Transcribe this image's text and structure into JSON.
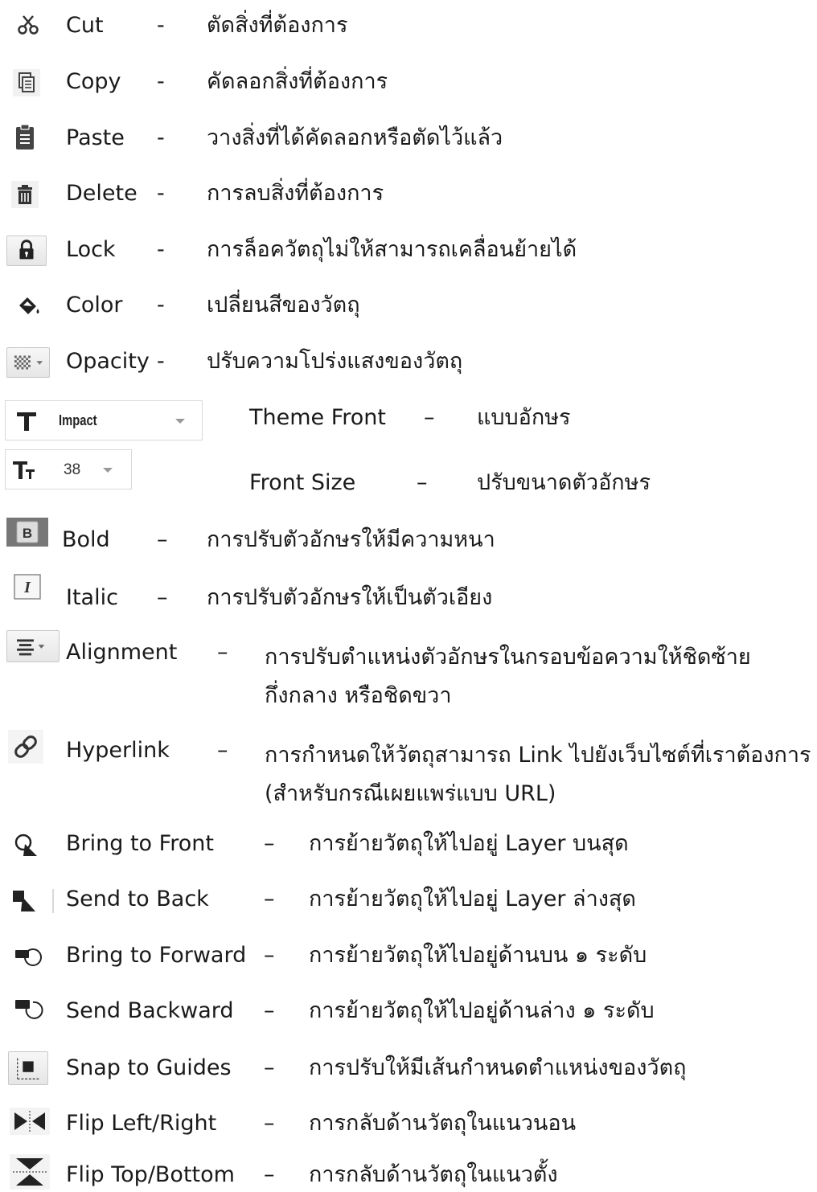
{
  "items": [
    {
      "icon": "scissors-icon",
      "label": "Cut",
      "sep": "-",
      "desc": "ตัดสิ่งที่ต้องการ"
    },
    {
      "icon": "copy-icon",
      "label": "Copy",
      "sep": "-",
      "desc": "คัดลอกสิ่งที่ต้องการ"
    },
    {
      "icon": "paste-icon",
      "label": "Paste",
      "sep": "-",
      "desc": "วางสิ่งที่ได้คัดลอกหรือตัดไว้แล้ว"
    },
    {
      "icon": "trash-icon",
      "label": "Delete",
      "sep": "-",
      "desc": "การลบสิ่งที่ต้องการ"
    },
    {
      "icon": "lock-icon",
      "label": "Lock",
      "sep": "-",
      "desc": "การล็อควัตถุไม่ให้สามารถเคลื่อนย้ายได้"
    },
    {
      "icon": "paint-bucket-icon",
      "label": "Color",
      "sep": "-",
      "desc": "เปลี่ยนสีของวัตถุ"
    },
    {
      "icon": "opacity-icon",
      "label": "Opacity",
      "sep": "-",
      "desc": "ปรับความโปร่งแสงของวัตถุ"
    },
    {
      "icon": "font-family-icon",
      "label": "Theme Front",
      "sep": "–",
      "desc": "แบบอักษร",
      "control_value": "Impact"
    },
    {
      "icon": "font-size-icon",
      "label": "Front Size",
      "sep": "–",
      "desc": "ปรับขนาดตัวอักษร",
      "control_value": "38"
    },
    {
      "icon": "bold-icon",
      "label": "Bold",
      "sep": "–",
      "desc": "การปรับตัวอักษรให้มีความหนา"
    },
    {
      "icon": "italic-icon",
      "label": "Italic",
      "sep": "–",
      "desc": "การปรับตัวอักษรให้เป็นตัวเอียง"
    },
    {
      "icon": "align-icon",
      "label": "Alignment",
      "sep": "–",
      "desc": "การปรับตำแหน่งตัวอักษรในกรอบข้อความให้ชิดซ้าย กึ่งกลาง หรือชิดขวา"
    },
    {
      "icon": "hyperlink-icon",
      "label": "Hyperlink",
      "sep": "–",
      "desc": "การกำหนดให้วัตถุสามารถ Link ไปยังเว็บไซต์ที่เราต้องการ (สำหรับกรณีเผยแพร่แบบ URL)"
    },
    {
      "icon": "bring-to-front-icon",
      "label": "Bring to Front",
      "sep": "–",
      "desc": "การย้ายวัตถุให้ไปอยู่ Layer บนสุด"
    },
    {
      "icon": "send-to-back-icon",
      "label": "Send to Back",
      "sep": "–",
      "desc": "การย้ายวัตถุให้ไปอยู่ Layer ล่างสุด"
    },
    {
      "icon": "bring-forward-icon",
      "label": "Bring to Forward",
      "sep": "–",
      "desc": "การย้ายวัตถุให้ไปอยู่ด้านบน ๑ ระดับ"
    },
    {
      "icon": "send-backward-icon",
      "label": "Send Backward",
      "sep": "–",
      "desc": "การย้ายวัตถุให้ไปอยู่ด้านล่าง ๑ ระดับ"
    },
    {
      "icon": "snap-guides-icon",
      "label": "Snap to Guides",
      "sep": "–",
      "desc": "การปรับให้มีเส้นกำหนดตำแหน่งของวัตถุ"
    },
    {
      "icon": "flip-horizontal-icon",
      "label": "Flip Left/Right",
      "sep": "–",
      "desc": "การกลับด้านวัตถุในแนวนอน"
    },
    {
      "icon": "flip-vertical-icon",
      "label": "Flip Top/Bottom",
      "sep": "–",
      "desc": "การกลับด้านวัตถุในแนวตั้ง"
    }
  ]
}
